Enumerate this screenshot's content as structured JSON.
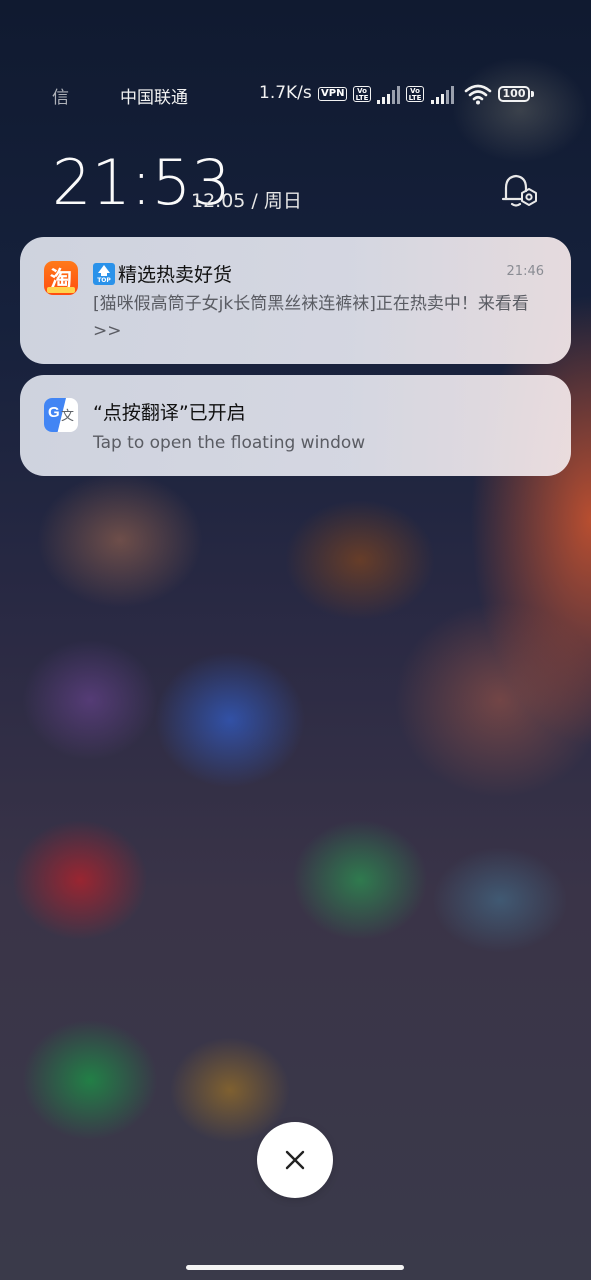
{
  "status_bar": {
    "truncated_text": "信",
    "carrier": "中国联通",
    "speed": "1.7K/s",
    "vpn_label": "VPN",
    "volte_label_top": "Vo",
    "volte_label_bottom": "LTE",
    "battery_level": "100"
  },
  "lockscreen": {
    "time": "21:53",
    "date": "12.05 / 周日"
  },
  "notifications": [
    {
      "app": "taobao",
      "icon_char": "淘",
      "badge_text": "TOP",
      "title": "精选热卖好货",
      "time": "21:46",
      "body": "[猫咪假高筒子女jk长筒黑丝袜连裤袜]正在热卖中！来看看>>"
    },
    {
      "app": "translate",
      "icon_letters": "G",
      "icon_char": "文",
      "title": "“点按翻译”已开启",
      "body": "Tap to open the floating window"
    }
  ],
  "colors": {
    "card_background": "#dadde7",
    "taobao_orange": "#ff5a12",
    "translate_blue": "#4285f4",
    "top_badge_blue": "#2a92ea"
  }
}
